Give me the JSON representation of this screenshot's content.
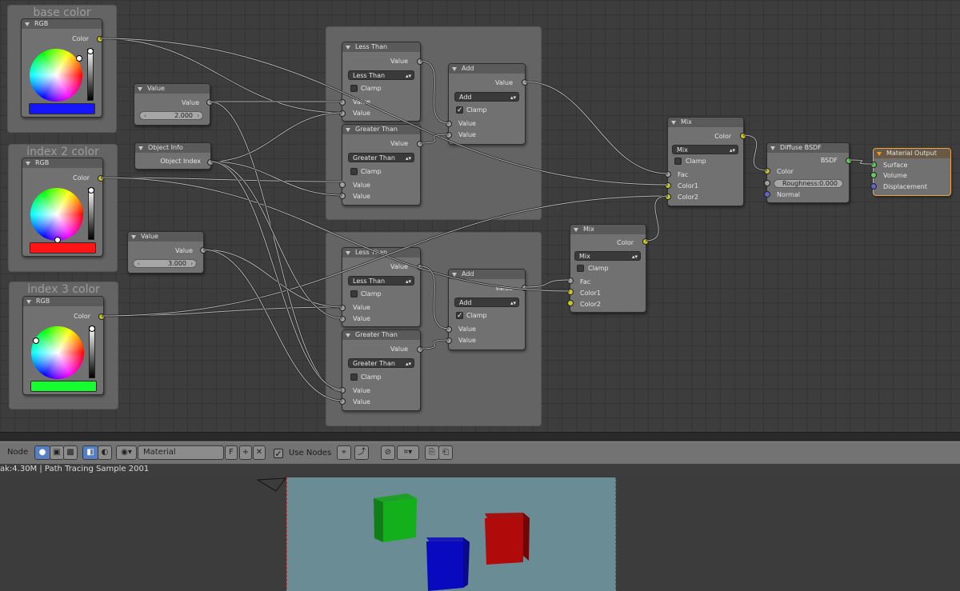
{
  "frames": [
    {
      "label": "base color"
    },
    {
      "label": "index 2 color"
    },
    {
      "label": "index 3 color"
    }
  ],
  "rgb_nodes": [
    {
      "title": "RGB",
      "output": "Color",
      "swatch": "#1515ff"
    },
    {
      "title": "RGB",
      "output": "Color",
      "swatch": "#ff1515"
    },
    {
      "title": "RGB",
      "output": "Color",
      "swatch": "#15ff2e"
    }
  ],
  "value_nodes": [
    {
      "title": "Value",
      "output": "Value",
      "value": "2.000"
    },
    {
      "title": "Value",
      "output": "Value",
      "value": "3.000"
    }
  ],
  "object_info": {
    "title": "Object Info",
    "output": "Object Index"
  },
  "math_groups": [
    {
      "less_than": {
        "title": "Less Than",
        "output": "Value",
        "operation": "Less Than",
        "clamp": "Clamp",
        "in1": "Value",
        "in2": "Value"
      },
      "greater_than": {
        "title": "Greater Than",
        "output": "Value",
        "operation": "Greater Than",
        "clamp": "Clamp",
        "in1": "Value",
        "in2": "Value"
      },
      "add": {
        "title": "Add",
        "output": "Value",
        "operation": "Add",
        "clamp": "Clamp",
        "in1": "Value",
        "in2": "Value"
      }
    },
    {
      "less_than": {
        "title": "Less Than",
        "output": "Value",
        "operation": "Less Than",
        "clamp": "Clamp",
        "in1": "Value",
        "in2": "Value"
      },
      "greater_than": {
        "title": "Greater Than",
        "output": "Value",
        "operation": "Greater Than",
        "clamp": "Clamp",
        "in1": "Value",
        "in2": "Value"
      },
      "add": {
        "title": "Add",
        "output": "Value",
        "operation": "Add",
        "clamp": "Clamp",
        "in1": "Value",
        "in2": "Value"
      }
    }
  ],
  "mix_nodes": [
    {
      "title": "Mix",
      "output": "Color",
      "blend": "Mix",
      "clamp": "Clamp",
      "fac": "Fac",
      "color1": "Color1",
      "color2": "Color2"
    },
    {
      "title": "Mix",
      "output": "Color",
      "blend": "Mix",
      "clamp": "Clamp",
      "fac": "Fac",
      "color1": "Color1",
      "color2": "Color2"
    }
  ],
  "diffuse": {
    "title": "Diffuse BSDF",
    "output": "BSDF",
    "color": "Color",
    "roughness_label": "Roughness:",
    "roughness": "0.000",
    "normal": "Normal"
  },
  "material_output": {
    "title": "Material Output",
    "surface": "Surface",
    "volume": "Volume",
    "displacement": "Displacement"
  },
  "toolbar": {
    "menu_node": "Node",
    "material_name": "Material",
    "fake_user": "F",
    "use_nodes": "Use Nodes"
  },
  "status_text": "ak:4.30M | Path Tracing Sample 2001",
  "colors": {
    "socket_gray": "#a1a1a1",
    "socket_yellow": "#c7c729",
    "socket_green": "#63c763",
    "socket_blue": "#6363c7",
    "selected_border": "#e8a948",
    "render_bg": "#6a8d95"
  }
}
